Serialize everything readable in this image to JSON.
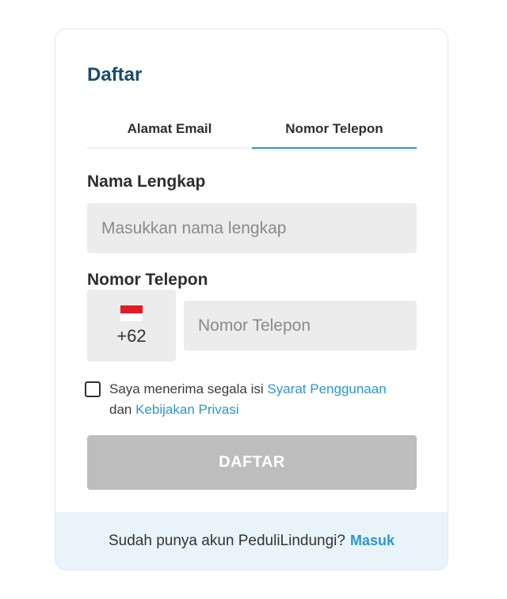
{
  "form": {
    "title": "Daftar",
    "tabs": [
      {
        "label": "Alamat Email",
        "active": false
      },
      {
        "label": "Nomor Telepon",
        "active": true
      }
    ],
    "name_label": "Nama Lengkap",
    "name_placeholder": "Masukkan nama lengkap",
    "name_value": "",
    "phone_label": "Nomor Telepon",
    "country_code": "+62",
    "country_flag": "indonesia-flag-icon",
    "phone_placeholder": "Nomor Telepon",
    "phone_value": "",
    "agreement": {
      "checked": false,
      "prefix": "Saya menerima segala isi",
      "terms_link": "Syarat Penggunaan",
      "conjunction": "dan",
      "privacy_link": "Kebijakan Privasi"
    },
    "submit_label": "DAFTAR",
    "submit_disabled": true
  },
  "footer": {
    "prompt": "Sudah punya akun PeduliLindungi?",
    "login_link": "Masuk"
  },
  "colors": {
    "title": "#1a4a6b",
    "accent": "#2a97d3",
    "input_bg": "#ececec",
    "button_disabled": "#bdbdbd",
    "footer_bg": "#e8f4fa",
    "flag_red": "#e31b23"
  }
}
